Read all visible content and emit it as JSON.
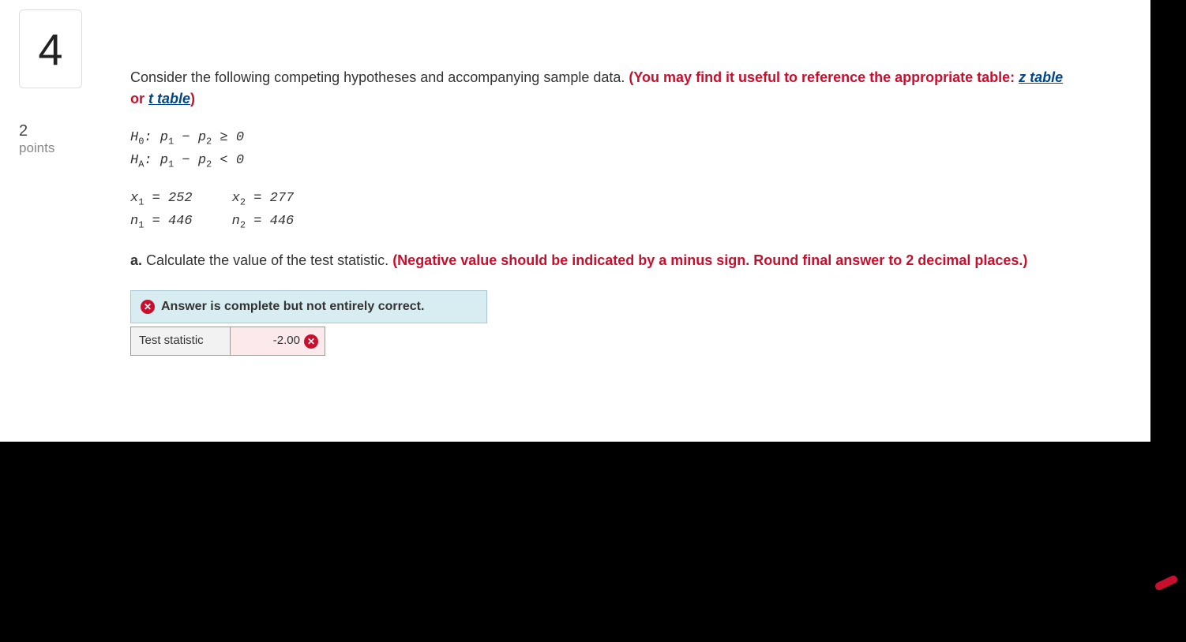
{
  "question_number": "4",
  "points": {
    "value": "2",
    "label": "points"
  },
  "intro": {
    "plain": "Consider the following competing hypotheses and accompanying sample data. ",
    "hint_prefix": "(You may find it useful to reference the appropriate table: ",
    "z_link": "z table",
    "or": " or ",
    "t_link": "t table",
    "hint_suffix": ")"
  },
  "hypotheses": {
    "h0_label": "H",
    "h0_sub": "0",
    "h0_body": ": p",
    "p1sub": "1",
    "minus": " − p",
    "p2sub": "2",
    "h0_cmp": " ≥ 0",
    "ha_label": "H",
    "ha_sub": "A",
    "ha_body": ": p",
    "ha_cmp": " < 0"
  },
  "data": {
    "x1_label": "x",
    "x1_sub": "1",
    "x1_eq": " = 252",
    "x2_label": "x",
    "x2_sub": "2",
    "x2_eq": " = 277",
    "n1_label": "n",
    "n1_sub": "1",
    "n1_eq": " = 446",
    "n2_label": "n",
    "n2_sub": "2",
    "n2_eq": " = 446"
  },
  "partA": {
    "letter": "a.",
    "text": " Calculate the value of the test statistic. ",
    "red": "(Negative value should be indicated by a minus sign. Round final answer to 2 decimal places.)"
  },
  "feedback": {
    "message": "Answer is complete but not entirely correct."
  },
  "answer": {
    "label": "Test statistic",
    "value": "-2.00",
    "correct": false
  }
}
